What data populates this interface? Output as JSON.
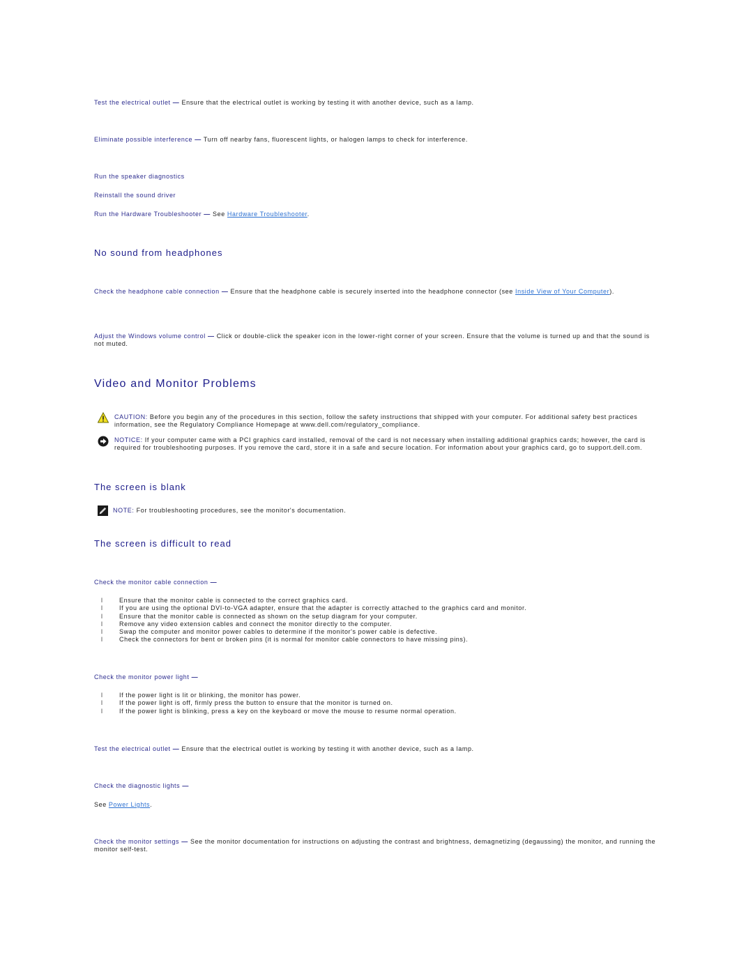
{
  "colors": {
    "heading": "#1c1c8a",
    "label": "#2b2b8e",
    "link": "#2a6fd1",
    "text": "#222222"
  },
  "audio": {
    "test_outlet": {
      "label": "Test the electrical outlet",
      "dash": "—",
      "text": " Ensure that the electrical outlet is working by testing it with another device, such as a lamp."
    },
    "interference": {
      "label": "Eliminate possible interference",
      "dash": "—",
      "text": " Turn off nearby fans, fluorescent lights, or halogen lamps to check for interference."
    },
    "speaker_diag": {
      "label": "Run the speaker diagnostics"
    },
    "reinstall": {
      "label": "Reinstall the sound driver"
    },
    "hw_troubleshooter": {
      "label": "Run the Hardware Troubleshooter",
      "dash": "—",
      "pre": " See ",
      "link": "Hardware Troubleshooter",
      "post": "."
    }
  },
  "headphones": {
    "heading": "No sound from headphones",
    "cable": {
      "label": "Check the headphone cable connection",
      "dash": "—",
      "text": " Ensure that the headphone cable is securely inserted into the headphone connector (see ",
      "link": "Inside View of Your Computer",
      "post": ")."
    },
    "volume": {
      "label": "Adjust the Windows volume control",
      "dash": "—",
      "text": " Click or double-click the speaker icon in the lower-right corner of your screen. Ensure that the volume is turned up and that the sound is not muted."
    }
  },
  "video": {
    "heading": "Video and Monitor Problems",
    "caution": {
      "label": "CAUTION:",
      "text": " Before you begin any of the procedures in this section, follow the safety instructions that shipped with your computer. For additional safety best practices information, see the Regulatory Compliance Homepage at www.dell.com/regulatory_compliance."
    },
    "notice": {
      "label": "NOTICE:",
      "text": " If your computer came with a PCI graphics card installed, removal of the card is not necessary when installing additional graphics cards; however, the card is required for troubleshooting purposes. If you remove the card, store it in a safe and secure location. For information about your graphics card, go to support.dell.com."
    },
    "blank": {
      "heading": "The screen is blank",
      "note": {
        "label": "NOTE:",
        "text": " For troubleshooting procedures, see the monitor's documentation."
      }
    },
    "difficult": {
      "heading": "The screen is difficult to read",
      "cable": {
        "label": "Check the monitor cable connection",
        "dash": "—",
        "items": [
          "Ensure that the monitor cable is connected to the correct graphics card.",
          "If you are using the optional DVI-to-VGA adapter, ensure that the adapter is correctly attached to the graphics card and monitor.",
          "Ensure that the monitor cable is connected as shown on the setup diagram for your computer.",
          "Remove any video extension cables and connect the monitor directly to the computer.",
          "Swap the computer and monitor power cables to determine if the monitor's power cable is defective.",
          "Check the connectors for bent or broken pins (it is normal for monitor cable connectors to have missing pins)."
        ]
      },
      "power_light": {
        "label": "Check the monitor power light",
        "dash": "—",
        "items": [
          "If the power light is lit or blinking, the monitor has power.",
          "If the power light is off, firmly press the button to ensure that the monitor is turned on.",
          "If the power light is blinking, press a key on the keyboard or move the mouse to resume normal operation."
        ]
      },
      "test_outlet": {
        "label": "Test the electrical outlet",
        "dash": "—",
        "text": " Ensure that the electrical outlet is working by testing it with another device, such as a lamp."
      },
      "diag_lights": {
        "label": "Check the diagnostic lights",
        "dash": "—",
        "pre": "See ",
        "link": "Power Lights",
        "post": "."
      },
      "settings": {
        "label": "Check the monitor settings",
        "dash": "—",
        "text": " See the monitor documentation for instructions on adjusting the contrast and brightness, demagnetizing (degaussing) the monitor, and running the monitor self-test."
      }
    }
  },
  "bullet_glyph": "l"
}
